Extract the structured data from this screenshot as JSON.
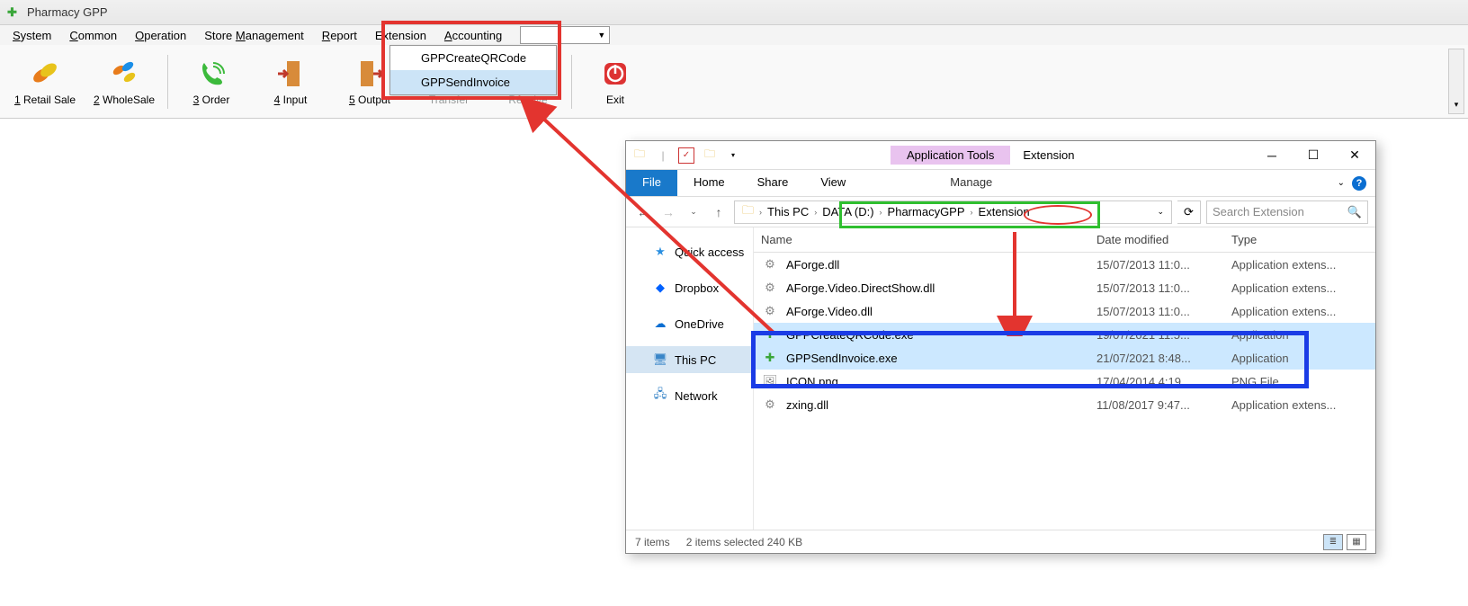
{
  "app": {
    "title": "Pharmacy GPP"
  },
  "menubar": {
    "system": "System",
    "common": "Common",
    "operation": "Operation",
    "store": "Store Management",
    "report": "Report",
    "extension": "Extension",
    "accounting": "Accounting"
  },
  "dropdown": {
    "item1": "GPPCreateQRCode",
    "item2": "GPPSendInvoice"
  },
  "toolbar": {
    "retail": "1 Retail Sale",
    "wholesale": "2 WholeSale",
    "order": "3 Order",
    "input": "4 Input",
    "output": "5 Output",
    "transfer": "Transfer",
    "receive": "Receive",
    "exit": "Exit"
  },
  "explorer": {
    "contextTab": "Application Tools",
    "title": "Extension",
    "ribbon": {
      "file": "File",
      "home": "Home",
      "share": "Share",
      "view": "View",
      "manage": "Manage"
    },
    "breadcrumb": {
      "thispc": "This PC",
      "drive": "DATA (D:)",
      "folder1": "PharmacyGPP",
      "folder2": "Extension"
    },
    "search_placeholder": "Search Extension",
    "navpane": {
      "quick": "Quick access",
      "dropbox": "Dropbox",
      "onedrive": "OneDrive",
      "thispc": "This PC",
      "network": "Network"
    },
    "columns": {
      "name": "Name",
      "date": "Date modified",
      "type": "Type"
    },
    "files": [
      {
        "name": "AForge.dll",
        "date": "15/07/2013 11:0...",
        "type": "Application extens...",
        "sel": false,
        "icon": "dll"
      },
      {
        "name": "AForge.Video.DirectShow.dll",
        "date": "15/07/2013 11:0...",
        "type": "Application extens...",
        "sel": false,
        "icon": "dll"
      },
      {
        "name": "AForge.Video.dll",
        "date": "15/07/2013 11:0...",
        "type": "Application extens...",
        "sel": false,
        "icon": "dll"
      },
      {
        "name": "GPPCreateQRCode.exe",
        "date": "19/07/2021 11:5...",
        "type": "Application",
        "sel": true,
        "icon": "exe"
      },
      {
        "name": "GPPSendInvoice.exe",
        "date": "21/07/2021 8:48...",
        "type": "Application",
        "sel": true,
        "icon": "exe"
      },
      {
        "name": "ICON.png",
        "date": "17/04/2014 4:19...",
        "type": "PNG File",
        "sel": false,
        "icon": "png"
      },
      {
        "name": "zxing.dll",
        "date": "11/08/2017 9:47...",
        "type": "Application extens...",
        "sel": false,
        "icon": "dll"
      }
    ],
    "status": {
      "count": "7 items",
      "selected": "2 items selected  240 KB"
    }
  }
}
